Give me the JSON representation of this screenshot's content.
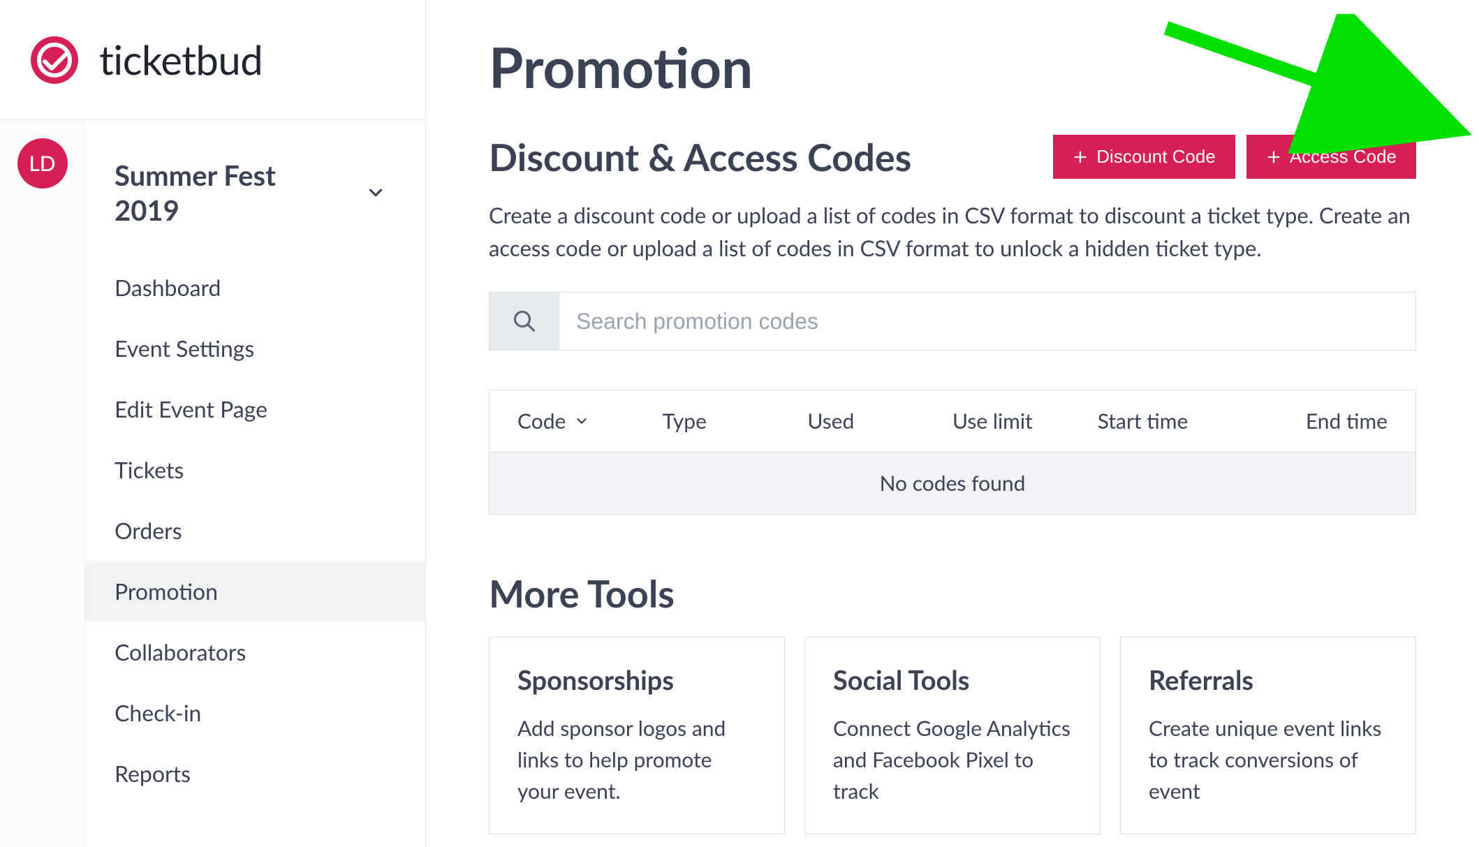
{
  "brand": {
    "name": "ticketbud"
  },
  "avatar": {
    "initials": "LD"
  },
  "sidebar": {
    "event_name": "Summer Fest 2019",
    "items": [
      {
        "label": "Dashboard"
      },
      {
        "label": "Event Settings"
      },
      {
        "label": "Edit Event Page"
      },
      {
        "label": "Tickets"
      },
      {
        "label": "Orders"
      },
      {
        "label": "Promotion"
      },
      {
        "label": "Collaborators"
      },
      {
        "label": "Check-in"
      },
      {
        "label": "Reports"
      }
    ],
    "active_index": 5
  },
  "page": {
    "title": "Promotion"
  },
  "codes_section": {
    "title": "Discount & Access Codes",
    "buttons": {
      "discount": "Discount Code",
      "access": "Access Code"
    },
    "description": "Create a discount code or upload a list of codes in CSV format to discount a ticket type. Create an access code or upload a list of codes in CSV format to unlock a hidden ticket type.",
    "search_placeholder": "Search promotion codes",
    "columns": {
      "code": "Code",
      "type": "Type",
      "used": "Used",
      "use_limit": "Use limit",
      "start_time": "Start time",
      "end_time": "End time"
    },
    "empty": "No codes found"
  },
  "more_tools": {
    "title": "More Tools",
    "cards": [
      {
        "title": "Sponsorships",
        "desc": "Add sponsor logos and links to help promote your event."
      },
      {
        "title": "Social Tools",
        "desc": "Connect Google Analytics and Facebook Pixel to track"
      },
      {
        "title": "Referrals",
        "desc": "Create unique event links to track conversions of event"
      }
    ]
  },
  "colors": {
    "accent": "#d61f55",
    "arrow": "#00e000"
  }
}
